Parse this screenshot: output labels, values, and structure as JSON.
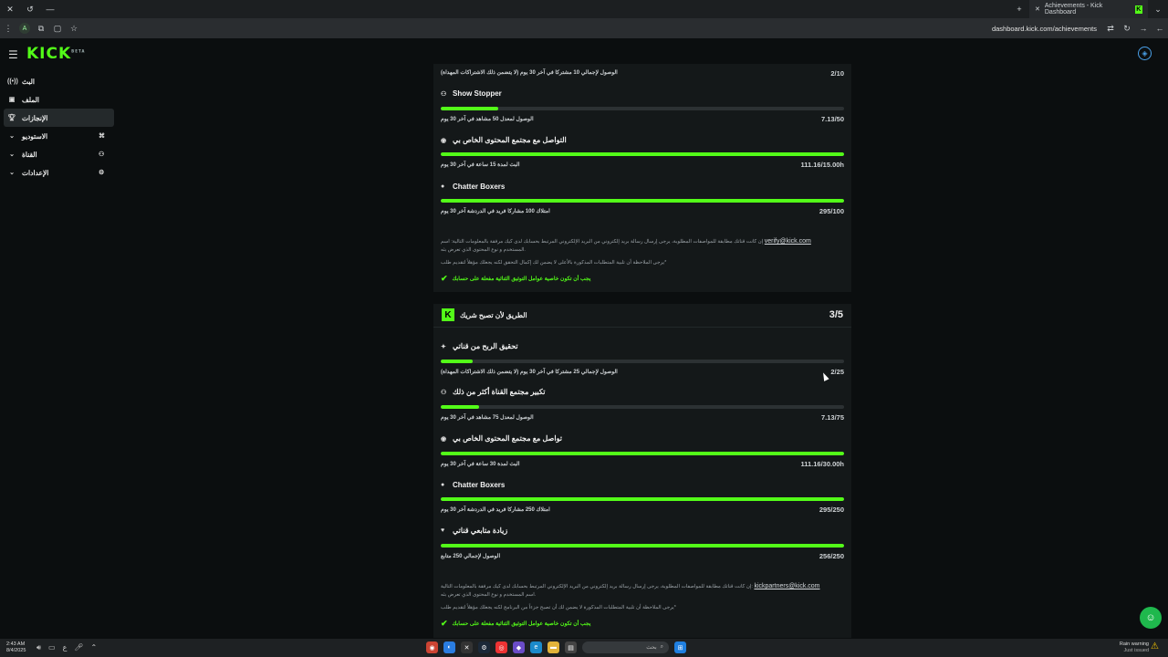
{
  "browser": {
    "tab_title": "Achievements - Kick Dashboard",
    "url": "dashboard.kick.com/achievements",
    "profile_initial": "A"
  },
  "header": {
    "logo": "KICK",
    "logo_badge": "BETA"
  },
  "sidebar": {
    "items": [
      {
        "label": "البث",
        "icon": "broadcast-icon"
      },
      {
        "label": "الملف",
        "icon": "profile-icon"
      },
      {
        "label": "الإنجازات",
        "icon": "trophy-icon",
        "active": true
      },
      {
        "label": "الاستوديو",
        "icon": "studio-icon"
      },
      {
        "label": "القناة",
        "icon": "channel-icon"
      },
      {
        "label": "الإعدادات",
        "icon": "settings-icon"
      }
    ]
  },
  "section1": {
    "top_row": {
      "desc": "الوصول لإجمالي 10 مشتركا في آخر 30 يوم (لا يتضمن ذلك الاشتراكات المهداة)",
      "value": "2/10"
    },
    "achievements": [
      {
        "title": "Show Stopper",
        "icon": "users-icon",
        "progress": 0.143,
        "desc": "الوصول لمعدل 50 مشاهد في آخر 30 يوم",
        "value": "7.13/50"
      },
      {
        "title": "التواصل مع مجتمع المحتوى الخاص بي",
        "icon": "broadcast-icon",
        "progress": 1.0,
        "desc": "البث لمدة 15 ساعة في آخر 30 يوم",
        "value": "111.16/15.00h"
      },
      {
        "title": "Chatter Boxers",
        "icon": "chat-icon",
        "progress": 1.0,
        "desc": "امتلاك 100 مشاركا فريد في الدردشة آخر 30 يوم",
        "value": "295/100"
      }
    ],
    "note_line1_a": "إن كانت قناتك مطابقة للمواصفات المطلوبة، يرجى إرسال رسالة بريد إلكتروني من البريد الإلكتروني المرتبط بحسابك لدى كيك مرفقة بالمعلومات التالية: اسم",
    "email": "verify@kick.com",
    "note_line2": "المستخدم و نوع المحتوى الذي تعرض بثه.",
    "note_line3": "يرجى الملاحظة أن تلبية المتطلبات المذكورة بالأعلى لا يضمن لك إكمال التحقق لكنه يجعلك مؤهلاً لتقديم طلب*",
    "requirement": "يجب أن تكون خاصية عوامل التوثيق الثنائية مفعلة على حسابك"
  },
  "section2": {
    "title": "الطريق لأن تصبح شريك",
    "count": "3/5",
    "achievements": [
      {
        "title": "تحقيق الربح من قناتي",
        "icon": "sparkle-icon",
        "progress": 0.08,
        "desc": "الوصول لإجمالي 25 مشتركا في آخر 30 يوم (لا يتضمن ذلك الاشتراكات المهداة)",
        "value": "2/25"
      },
      {
        "title": "تكبير مجتمع القناة أكثر من ذلك",
        "icon": "users-icon",
        "progress": 0.095,
        "desc": "الوصول لمعدل 75 مشاهد في آخر 30 يوم",
        "value": "7.13/75"
      },
      {
        "title": "تواصل مع مجتمع المحتوى الخاص بي",
        "icon": "broadcast-icon",
        "progress": 1.0,
        "desc": "البث لمدة 30 ساعة في آخر 30 يوم",
        "value": "111.16/30.00h"
      },
      {
        "title": "Chatter Boxers",
        "icon": "chat-icon",
        "progress": 1.0,
        "desc": "امتلاك 250 مشاركا فريد في الدردشة آخر 30 يوم",
        "value": "295/250"
      },
      {
        "title": "زيادة متابعي قناتي",
        "icon": "heart-icon",
        "progress": 1.0,
        "desc": "الوصول لإجمالي 250 متابع",
        "value": "256/250"
      }
    ],
    "note_line1_a": "إن كانت قناتك مطابقة للمواصفات المطلوبة، يرجى إرسال رسالة بريد إلكتروني من البريد الإلكتروني المرتبط بحسابك لدى كيك مرفقة بالمعلومات التالية:",
    "email": "kickpartners@kick.com",
    "note_line2": "اسم المستخدم و نوع المحتوى الذي تعرض بثه.",
    "note_line3": "يرجى الملاحظة أن تلبية المتطلبات المذكورة لا يضمن لك أن تصبح جزءاً من البرنامج لكنه يجعلك مؤهلاً لتقديم طلب*",
    "requirement": "يجب أن تكون خاصية عوامل التوثيق الثنائية مفعلة على حسابك"
  },
  "taskbar": {
    "time": "2:43 AM",
    "date": "8/4/2025",
    "lang": "ع",
    "search_placeholder": "بحث",
    "weather_title": "Rain warning",
    "weather_sub": "Just issued"
  },
  "colors": {
    "accent": "#53fc18",
    "background": "#0b0e0f",
    "card": "#141819",
    "track": "#2c3133"
  }
}
